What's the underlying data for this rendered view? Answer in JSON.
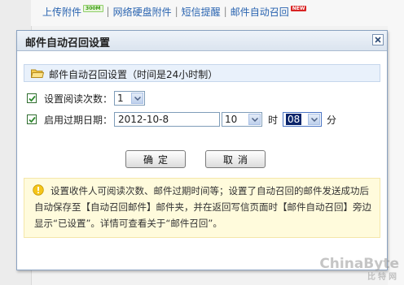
{
  "top_links": {
    "upload": "上传附件",
    "upload_badge": "300M",
    "netdisk": "网络硬盘附件",
    "sms": "短信提醒",
    "recall": "邮件自动召回",
    "recall_badge": "NEW",
    "sep": "|"
  },
  "dialog": {
    "title": "邮件自动召回设置",
    "section_title": "邮件自动召回设置（时间是24小时制）",
    "read_count_label": "设置阅读次数：",
    "read_count_value": "1",
    "expire_label": "启用过期日期：",
    "expire_date": "2012-10-8",
    "hour_value": "10",
    "hour_unit": "时",
    "minute_value": "08",
    "minute_unit": "分",
    "ok_button": "确定",
    "cancel_button": "取消",
    "notice": "设置收件人可阅读次数、邮件过期时间等；设置了自动召回的邮件发送成功后自动保存至【自动召回邮件】邮件夹，并在返回写信页面时【邮件自动召回】旁边显示“已设置”。详情可查看关于“邮件召回”。"
  },
  "watermark": {
    "line1": "ChinaByte",
    "line2": "比特网"
  },
  "colors": {
    "link": "#2a64b0",
    "section_bg": "#e9f1fb",
    "notice_bg": "#fffbdc",
    "check_green": "#2f8a2f"
  }
}
